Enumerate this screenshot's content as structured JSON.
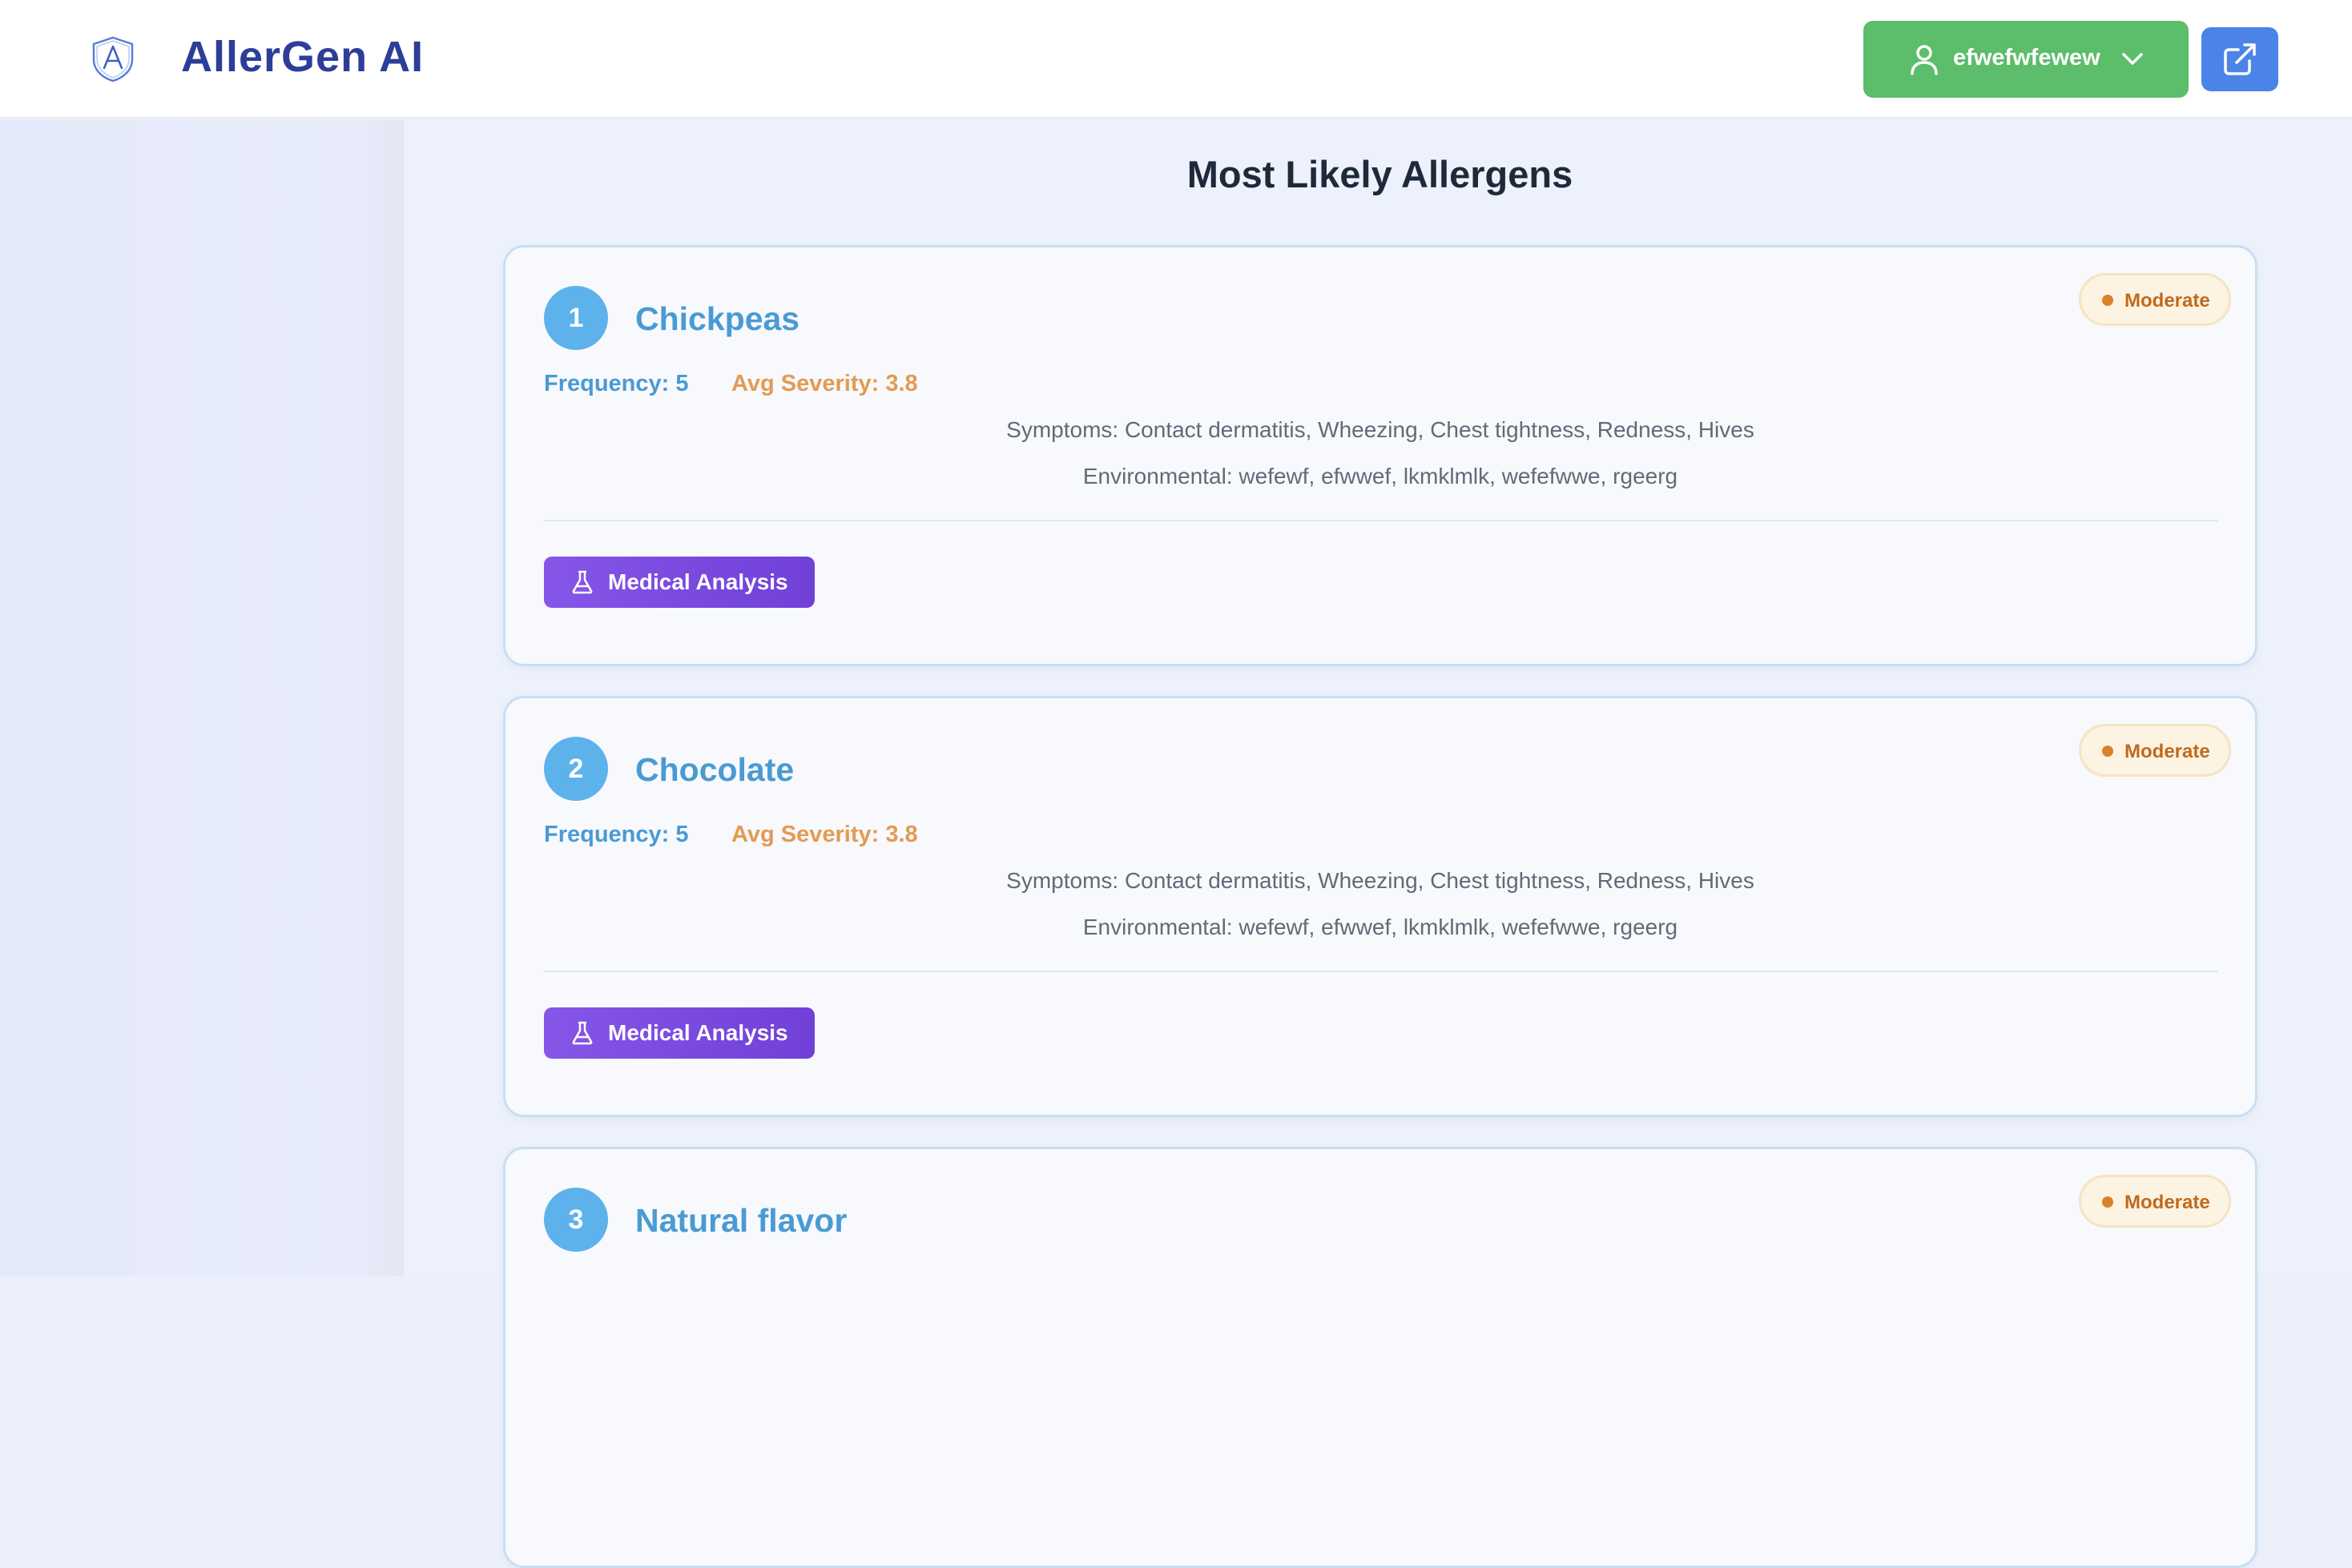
{
  "header": {
    "app_title": "AllerGen AI",
    "logo_icon": "shield-a-logo",
    "user": {
      "name": "efwefwfewew",
      "icon": "user-icon",
      "chevron_icon": "chevron-down-icon"
    },
    "external_icon": "external-link-icon"
  },
  "main": {
    "title": "Most Likely Allergens",
    "allergens": [
      {
        "rank": "1",
        "name": "Chickpeas",
        "badge": "Moderate",
        "frequency": "Frequency: 5",
        "severity": "Avg Severity: 3.8",
        "symptoms": "Symptoms: Contact dermatitis, Wheezing, Chest tightness, Redness, Hives",
        "environmental": "Environmental: wefewf, efwwef, lkmklmlk, wefefwwe, rgeerg",
        "button": "Medical Analysis"
      },
      {
        "rank": "2",
        "name": "Chocolate",
        "badge": "Moderate",
        "frequency": "Frequency: 5",
        "severity": "Avg Severity: 3.8",
        "symptoms": "Symptoms: Contact dermatitis, Wheezing, Chest tightness, Redness, Hives",
        "environmental": "Environmental: wefewf, efwwef, lkmklmlk, wefefwwe, rgeerg",
        "button": "Medical Analysis"
      },
      {
        "rank": "3",
        "name": "Natural flavor",
        "badge": "Moderate"
      }
    ]
  },
  "colors": {
    "brand": "#2c3e99",
    "user_button": "#5cbd6b",
    "external_button": "#4a84e8",
    "rank_circle": "#5db2ec",
    "allergen_name": "#4a9ad4",
    "severity_text": "#e49a52",
    "badge_text": "#c06a1c",
    "analysis_button": "#7a4ae0"
  }
}
